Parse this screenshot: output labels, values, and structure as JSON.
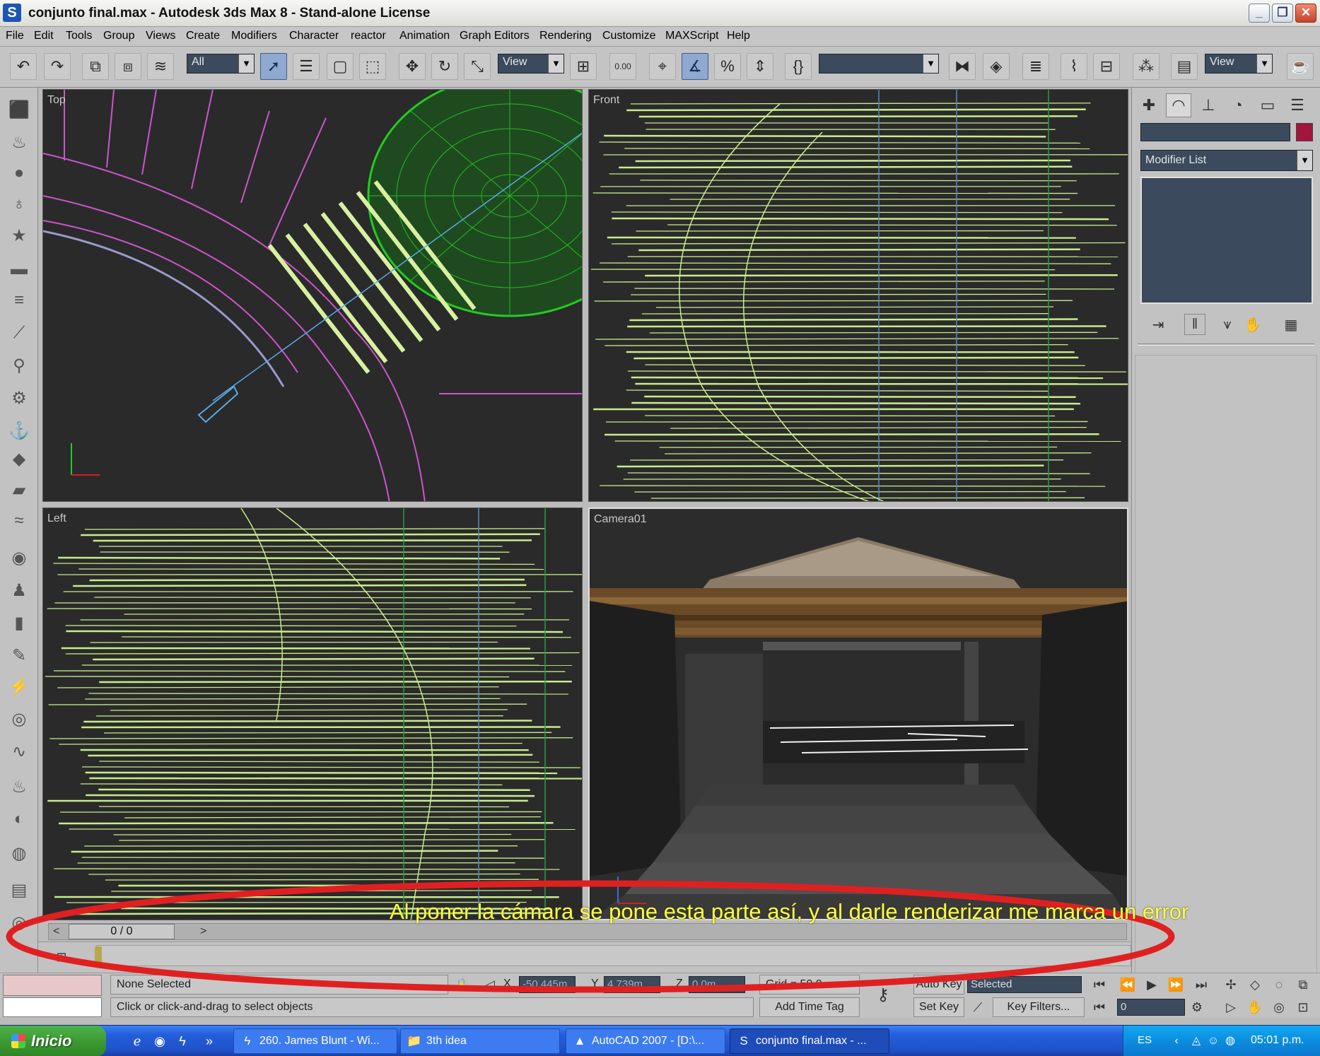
{
  "window": {
    "title": "conjunto final.max - Autodesk 3ds Max 8  - Stand-alone License",
    "app_icon": "3ds-max-logo-icon",
    "controls": {
      "minimize": "_",
      "maximize": "❐",
      "close": "✕"
    }
  },
  "menu": [
    "File",
    "Edit",
    "Tools",
    "Group",
    "Views",
    "Create",
    "Modifiers",
    "Character",
    "reactor",
    "Animation",
    "Graph Editors",
    "Rendering",
    "Customize",
    "MAXScript",
    "Help"
  ],
  "toolbar": {
    "selection_filter": "All",
    "ref_coord_system": "View",
    "spinner_snap_value": "0.00",
    "named_selection": "",
    "render_view": "View",
    "icons": [
      "undo-icon",
      "redo-icon",
      "select-link-icon",
      "unlink-icon",
      "bind-spacewarp-icon",
      "select-object-icon",
      "select-by-name-icon",
      "rect-selection-icon",
      "window-crossing-icon",
      "move-icon",
      "rotate-icon",
      "scale-icon",
      "pivot-icon",
      "snaps-icon",
      "angle-snap-icon",
      "percent-snap-icon",
      "spinner-snap-icon",
      "named-sets-icon",
      "mirror-icon",
      "align-icon",
      "layers-icon",
      "curve-editor-icon",
      "schematic-icon",
      "material-editor-icon",
      "render-scene-icon",
      "quick-render-icon"
    ]
  },
  "viewports": {
    "top": {
      "label": "Top"
    },
    "front": {
      "label": "Front"
    },
    "left": {
      "label": "Left"
    },
    "camera": {
      "label": "Camera01"
    }
  },
  "command_panel": {
    "tabs": [
      "create-tab-icon",
      "modify-tab-icon",
      "hierarchy-tab-icon",
      "motion-tab-icon",
      "display-tab-icon",
      "utilities-tab-icon"
    ],
    "object_name": "",
    "object_color": "#a3143f",
    "modifier_list": "Modifier List"
  },
  "timeline": {
    "frame_display": "0 / 0",
    "prev": "<",
    "next": ">"
  },
  "status": {
    "selection": "None Selected",
    "prompt": "Click or click-and-drag to select objects",
    "x_label": "X",
    "x_value": "-50.445m",
    "y_label": "Y",
    "y_value": "4.739m",
    "z_label": "Z",
    "z_value": "0.0m",
    "grid": "Grid = 50.0",
    "add_time_tag": "Add Time Tag",
    "auto_key": "Auto Key",
    "key_mode": "Selected",
    "set_key": "Set Key",
    "key_filters": "Key Filters...",
    "current_frame": "0"
  },
  "taskbar": {
    "start": "Inicio",
    "tasks": [
      {
        "label": "260. James Blunt - Wi...",
        "icon": "winamp-icon"
      },
      {
        "label": "3th idea",
        "icon": "folder-icon"
      },
      {
        "label": "AutoCAD 2007 - [D:\\...",
        "icon": "autocad-icon"
      },
      {
        "label": "conjunto final.max - ...",
        "icon": "3ds-max-icon"
      }
    ],
    "language": "ES",
    "clock": "05:01 p.m."
  },
  "annotation": {
    "text": "Al poner la cámara se pone esta parte así, y al darle renderizar me marca un error",
    "color": "#ffff3c",
    "ellipse_color": "#e02020"
  }
}
